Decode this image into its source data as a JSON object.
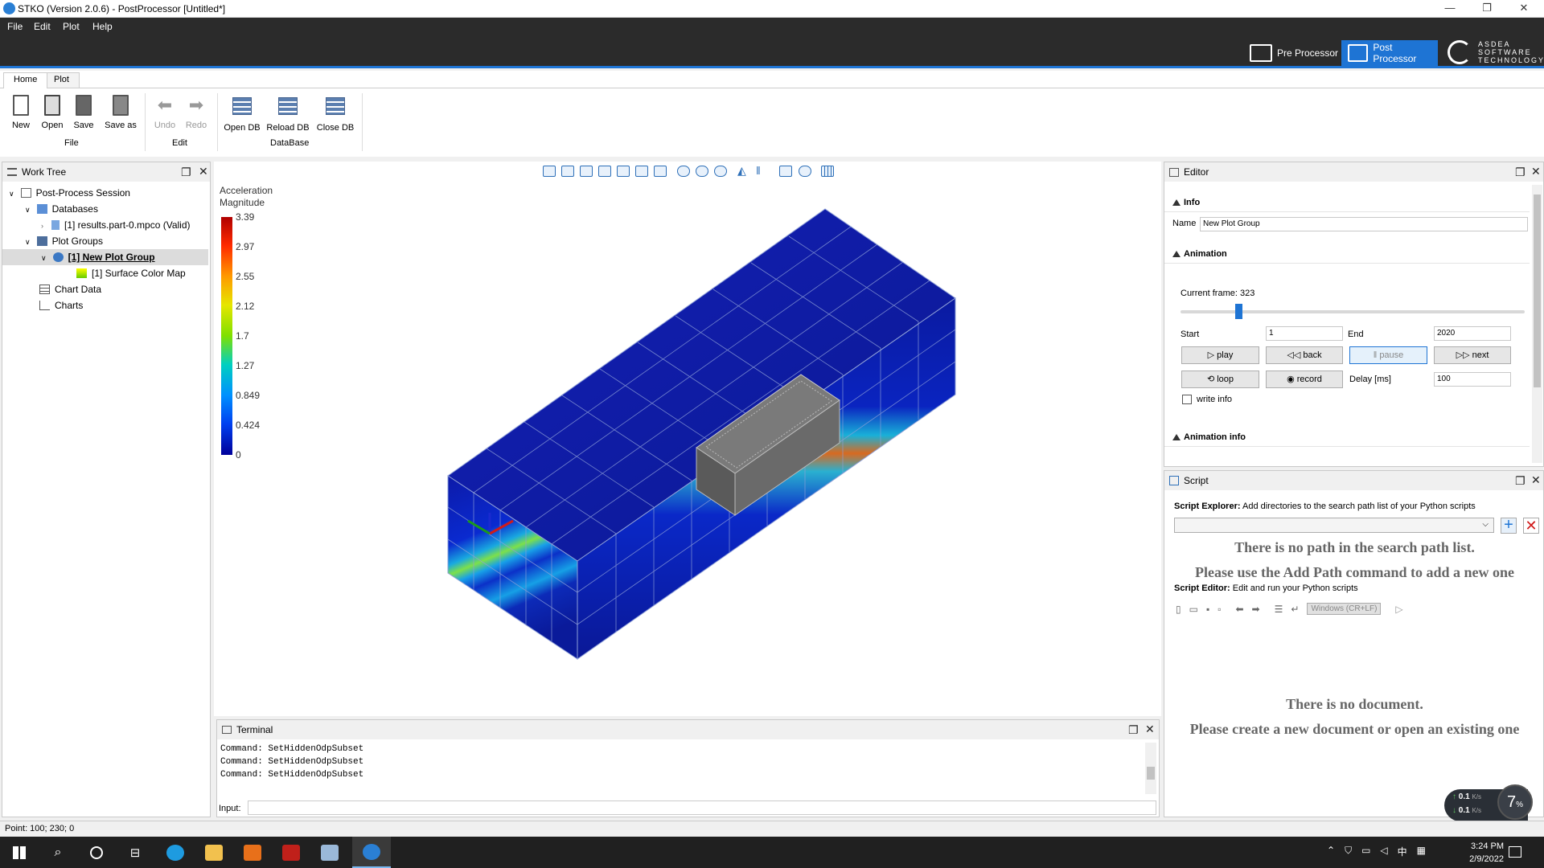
{
  "title": "STKO (Version 2.0.6) - PostProcessor [Untitled*]",
  "window_controls": [
    "—",
    "❐",
    "✕"
  ],
  "menu": [
    "File",
    "Edit",
    "Plot",
    "Help"
  ],
  "modes": {
    "pre": "Pre Processor",
    "post": "Post Processor"
  },
  "brand": {
    "name": "ASDEA",
    "line2": "SOFTWARE",
    "line3": "TECHNOLOGY"
  },
  "ribbon": {
    "tabs": [
      "Home",
      "Plot"
    ],
    "buttons": {
      "new": "New",
      "open": "Open",
      "save": "Save",
      "save_as": "Save as",
      "undo": "Undo",
      "redo": "Redo",
      "open_db": "Open DB",
      "reload_db": "Reload DB",
      "close_db": "Close DB"
    },
    "groups": {
      "file": "File",
      "edit": "Edit",
      "database": "DataBase"
    }
  },
  "work_tree": {
    "title": "Work Tree",
    "items": [
      "Post-Process Session",
      "Databases",
      "[1] results.part-0.mpco (Valid)",
      "Plot Groups",
      "[1] New Plot Group",
      "[1] Surface Color Map",
      "Chart Data",
      "Charts"
    ]
  },
  "legend": {
    "title1": "Acceleration",
    "title2": "Magnitude",
    "ticks": [
      "3.39",
      "2.97",
      "2.55",
      "2.12",
      "1.7",
      "1.27",
      "0.849",
      "0.424",
      "0"
    ]
  },
  "editor": {
    "title": "Editor",
    "info": "Info",
    "name_label": "Name",
    "name_value": "New Plot Group",
    "animation": "Animation",
    "current_frame": "Current frame: 323",
    "frame_fraction": 0.16,
    "start_label": "Start",
    "start_value": "1",
    "end_label": "End",
    "end_value": "2020",
    "play": "play",
    "back": "back",
    "pause": "pause",
    "next": "next",
    "loop": "loop",
    "record": "record",
    "delay_label": "Delay [ms]",
    "delay_value": "100",
    "write_info": "write info",
    "animation_info": "Animation info"
  },
  "script": {
    "title": "Script",
    "explorer_bold": "Script Explorer:",
    "explorer_text": "Add directories to the search path list of your Python scripts",
    "no_path1": "There is no path in the search path list.",
    "no_path2": "Please use the Add Path command to add a new one",
    "editor_bold": "Script Editor:",
    "editor_text": "Edit and run your Python scripts",
    "line_ending": "Windows (CR+LF)",
    "no_doc1": "There is no document.",
    "no_doc2": "Please create a new document or open an existing one"
  },
  "terminal": {
    "title": "Terminal",
    "lines": [
      "Command: SetHiddenOdpSubset",
      "Command: SetHiddenOdpSubset",
      "Command: SetHiddenOdpSubset"
    ],
    "input_label": "Input:"
  },
  "net": {
    "up": "0.1",
    "down": "0.1",
    "unit": "K/s",
    "cpu": "7",
    "cpu_unit": "%"
  },
  "status": "Point: 100; 230; 0",
  "clock": {
    "time": "3:24 PM",
    "date": "2/9/2022"
  },
  "tray": {
    "ime": "中"
  }
}
